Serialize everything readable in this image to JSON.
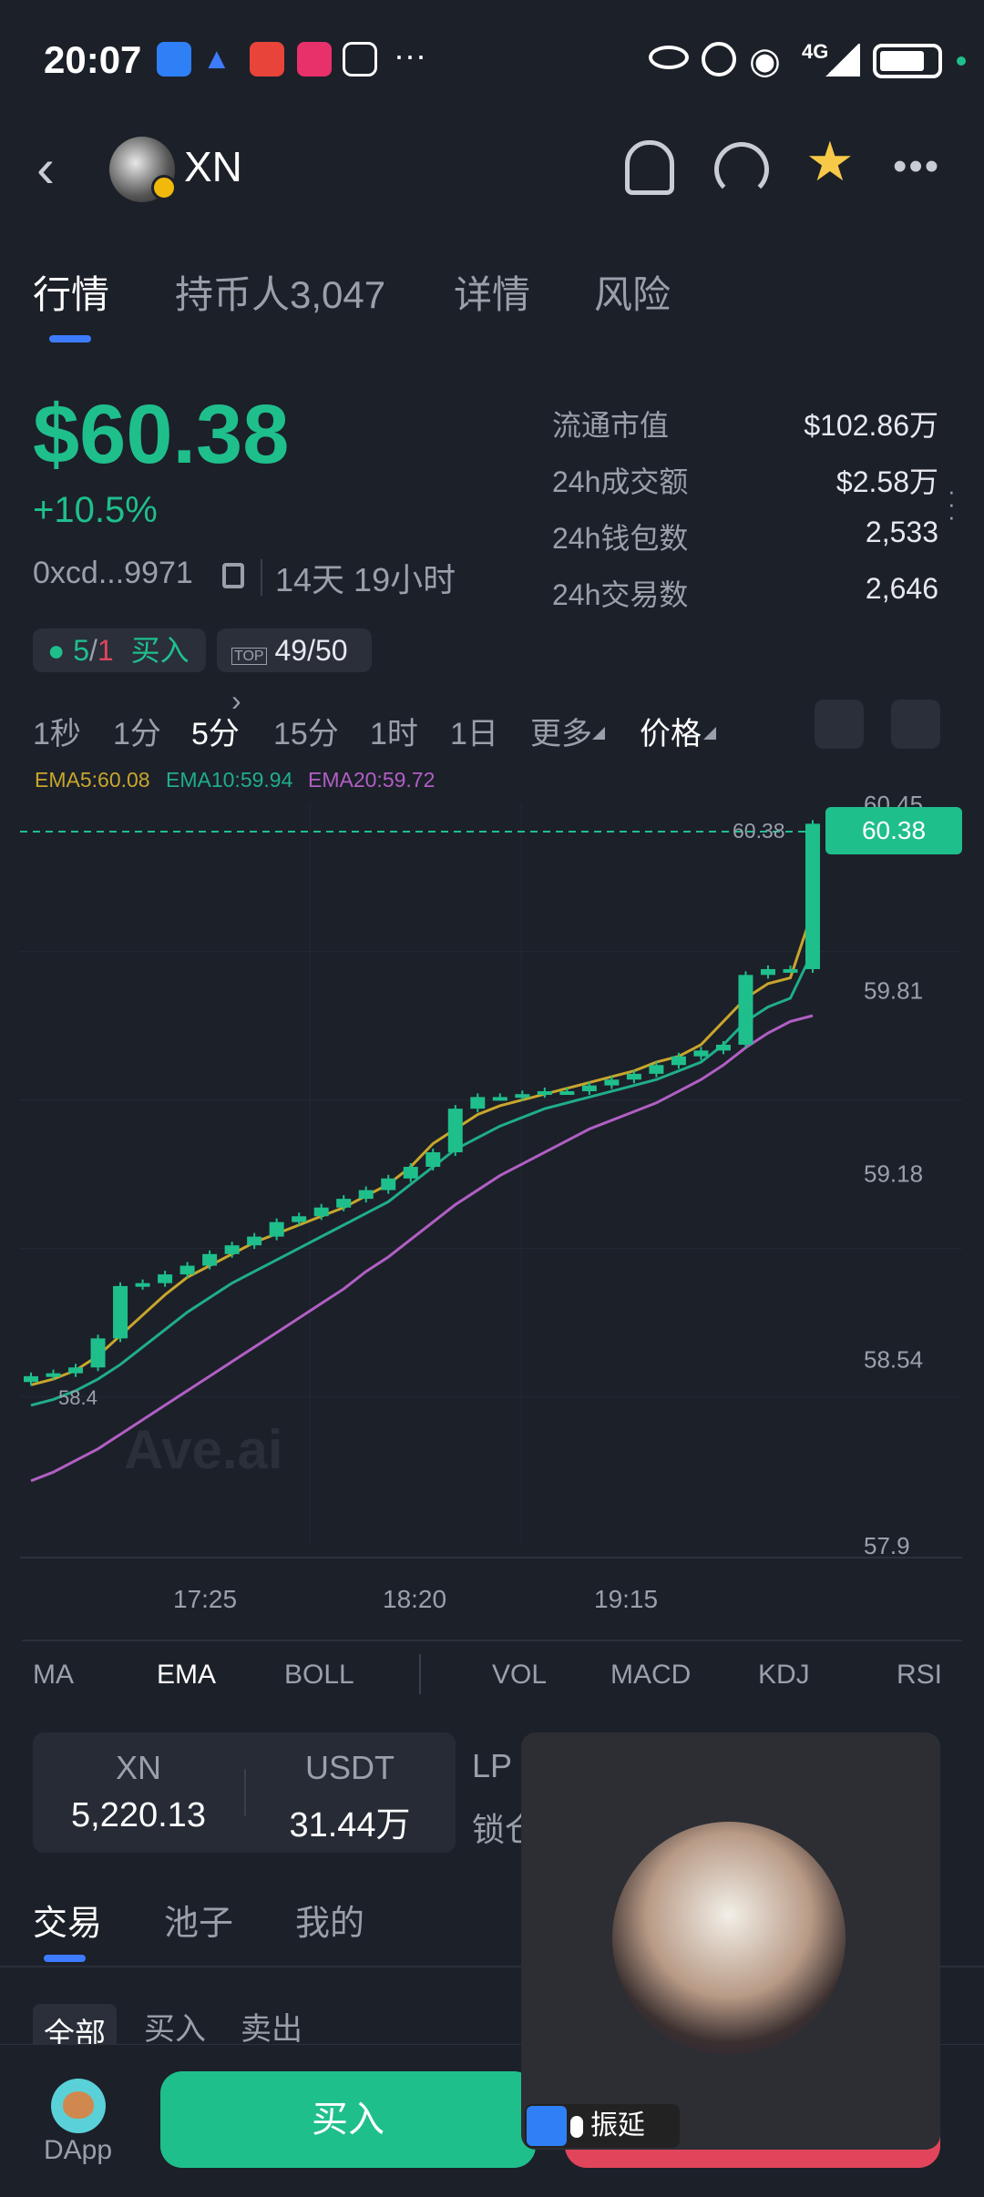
{
  "status_bar": {
    "time": "20:07",
    "network": "4G",
    "icons": [
      "lark-icon",
      "meeting-icon",
      "mail-icon",
      "video-icon",
      "hand-icon",
      "more-icon",
      "eye-icon",
      "alarm-icon",
      "wifi-icon",
      "signal-icon",
      "battery-icon"
    ]
  },
  "header": {
    "title": "XN",
    "icons": [
      "back-icon",
      "bell-icon",
      "gauge-icon",
      "star-icon",
      "more-icon"
    ],
    "star_color": "#f7c948"
  },
  "tabs": [
    {
      "label": "行情"
    },
    {
      "label": "持币人3,047"
    },
    {
      "label": "详情"
    },
    {
      "label": "风险"
    }
  ],
  "price": {
    "value": "$60.38",
    "change": "+10.5%",
    "address": "0xcd...9971",
    "age": "14天 19小时"
  },
  "stats": [
    {
      "label": "流通市值",
      "value": "$102.86万"
    },
    {
      "label": "24h成交额",
      "value": "$2.58万"
    },
    {
      "label": "24h钱包数",
      "value": "2,533"
    },
    {
      "label": "24h交易数",
      "value": "2,646"
    }
  ],
  "chips": {
    "ratio_buy": "5",
    "ratio_sep": "/",
    "ratio_sell": "1",
    "ratio_label": "买入",
    "top_value": "49/50"
  },
  "intervals": [
    "1秒",
    "1分",
    "5分",
    "15分",
    "1时",
    "1日",
    "更多",
    "价格"
  ],
  "active_interval": "5分",
  "ema": {
    "ema5": "EMA5:60.08",
    "ema10": "EMA10:59.94",
    "ema20": "EMA20:59.72"
  },
  "colors": {
    "up": "#1fbf8c",
    "down": "#e0455c",
    "accent": "#3d7bff",
    "ema5": "#c8a62c",
    "ema10": "#1fae8a",
    "ema20": "#b15fc4"
  },
  "chart_data": {
    "type": "candlestick",
    "y_ticks": [
      "60.45",
      "59.81",
      "59.18",
      "58.54",
      "57.9"
    ],
    "ylim": [
      57.9,
      60.45
    ],
    "x_ticks": [
      "17:25",
      "18:20",
      "19:15"
    ],
    "last_price_label": "60.38",
    "current_price": "60.38",
    "low_marker": "58.4",
    "watermark": "Ave.ai",
    "candles_close": [
      58.48,
      58.49,
      58.51,
      58.61,
      58.79,
      58.8,
      58.83,
      58.86,
      58.9,
      58.93,
      58.96,
      59.01,
      59.03,
      59.06,
      59.09,
      59.12,
      59.16,
      59.2,
      59.25,
      59.4,
      59.44,
      59.44,
      59.45,
      59.46,
      59.46,
      59.48,
      59.5,
      59.52,
      59.55,
      59.58,
      59.6,
      59.62,
      59.86,
      59.88,
      59.88,
      60.38
    ],
    "ema5": [
      58.45,
      58.47,
      58.5,
      58.55,
      58.62,
      58.69,
      58.76,
      58.82,
      58.86,
      58.9,
      58.94,
      58.97,
      59.0,
      59.03,
      59.06,
      59.1,
      59.14,
      59.2,
      59.28,
      59.33,
      59.38,
      59.41,
      59.43,
      59.45,
      59.47,
      59.49,
      59.51,
      59.53,
      59.56,
      59.58,
      59.62,
      59.7,
      59.78,
      59.83,
      59.85,
      60.08
    ],
    "ema10": [
      58.38,
      58.4,
      58.43,
      58.47,
      58.52,
      58.58,
      58.64,
      58.7,
      58.75,
      58.8,
      58.84,
      58.88,
      58.92,
      58.96,
      59.0,
      59.04,
      59.08,
      59.14,
      59.2,
      59.26,
      59.3,
      59.34,
      59.37,
      59.4,
      59.42,
      59.44,
      59.46,
      59.48,
      59.5,
      59.53,
      59.56,
      59.62,
      59.7,
      59.75,
      59.78,
      59.94
    ],
    "ema20": [
      58.12,
      58.15,
      58.19,
      58.23,
      58.28,
      58.33,
      58.38,
      58.43,
      58.48,
      58.53,
      58.58,
      58.63,
      58.68,
      58.73,
      58.78,
      58.84,
      58.89,
      58.95,
      59.01,
      59.07,
      59.12,
      59.17,
      59.21,
      59.25,
      59.29,
      59.33,
      59.36,
      59.39,
      59.42,
      59.46,
      59.5,
      59.55,
      59.61,
      59.66,
      59.7,
      59.72
    ]
  },
  "indicators": [
    "MA",
    "EMA",
    "BOLL",
    "VOL",
    "MACD",
    "KDJ",
    "RSI"
  ],
  "active_indicator": "EMA",
  "pool": {
    "token_label": "XN",
    "token_value": "5,220.13",
    "quote_label": "USDT",
    "quote_value": "31.44万",
    "lp_label": "LP",
    "lock_label": "锁仓"
  },
  "trade_tabs": [
    "交易",
    "池子",
    "我的"
  ],
  "filter_chips": [
    "全部",
    "买入",
    "卖出"
  ],
  "bottom": {
    "dapp_label": "DApp",
    "buy_label": "买入"
  },
  "floating_call": {
    "caller": "振延"
  }
}
